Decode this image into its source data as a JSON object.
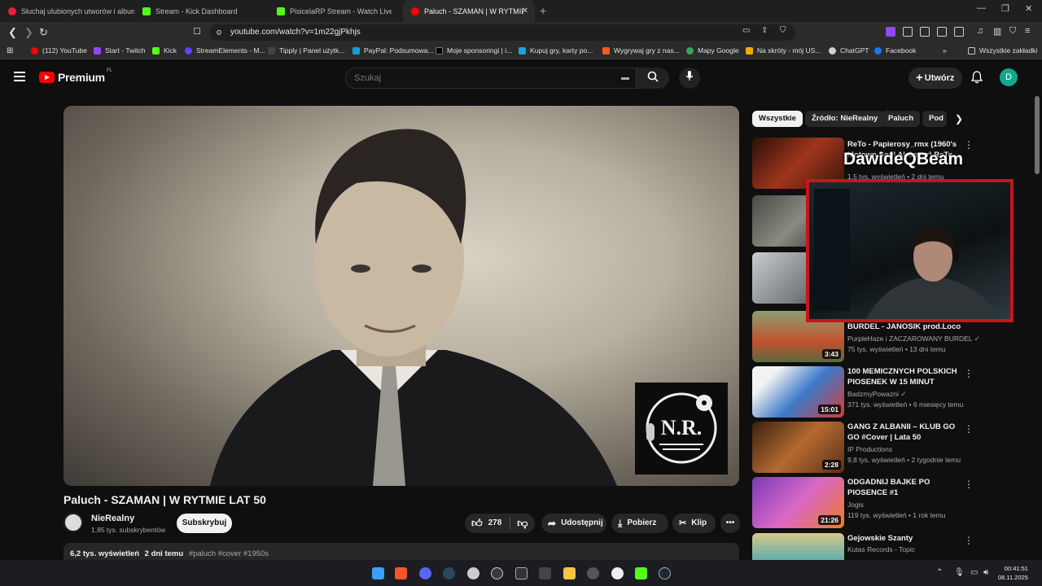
{
  "browser": {
    "tabs": [
      {
        "label": "Słuchaj ulubionych utworów i albumów",
        "color": "#e8213c"
      },
      {
        "label": "Stream - Kick Dashboard",
        "color": "#53fc18"
      },
      {
        "label": "PisicelaRP Stream - Watch Live on Kick",
        "color": "#53fc18"
      },
      {
        "label": "Paluch - SZAMAN | W RYTMIE LAT 50",
        "color": "#ff0000"
      }
    ],
    "new_tab": "+",
    "url": "youtube.com/watch?v=1m22gjPkhjs",
    "bookmarks": [
      {
        "label": "(112) YouTube",
        "color": "#ff0000"
      },
      {
        "label": "Start - Twitch",
        "color": "#9146ff"
      },
      {
        "label": "Kick",
        "color": "#53fc18"
      },
      {
        "label": "StreamElements - M...",
        "color": "#5a47ff"
      },
      {
        "label": "Tipply | Panel użytk...",
        "color": "#222222"
      },
      {
        "label": "PayPal: Podsumowa...",
        "color": "#169bd7"
      },
      {
        "label": "Moje sponsoringi | i...",
        "color": "#000000"
      },
      {
        "label": "Kupuj gry, karty po...",
        "color": "#1ba0e0"
      },
      {
        "label": "Wygrywaj gry z nas...",
        "color": "#ff5a1f"
      },
      {
        "label": "Mapy Google",
        "color": "#34a853"
      },
      {
        "label": "Na skróty - mój US...",
        "color": "#f2a900"
      },
      {
        "label": "ChatGPT",
        "color": "#d0d0d0"
      },
      {
        "label": "Facebook",
        "color": "#1877f2"
      }
    ],
    "all_bookmarks": "Wszystkie zakładki",
    "more_bookmarks": "»"
  },
  "youtube": {
    "logo_text": "Premium",
    "logo_region": "PL",
    "search_placeholder": "Szukaj",
    "create_label": "Utwórz",
    "avatar_letter": "D",
    "video": {
      "title": "Paluch - SZAMAN | W RYTMIE LAT 50",
      "channel": "NieRealny",
      "subscribers": "1,85 tys. subskrybentów",
      "subscribe_label": "Subskrybuj",
      "likes": "278",
      "share_label": "Udostępnij",
      "download_label": "Pobierz",
      "clip_label": "Klip",
      "views": "6,2 tys. wyświetleń",
      "age": "2 dni temu",
      "tags": "#paluch #cover #1950s",
      "logo_text": "N.R."
    },
    "chips": [
      "Wszystkie",
      "Źródło: NieRealny",
      "Paluch",
      "Pod"
    ],
    "recommendations": [
      {
        "title": "ReTo - Papierosy_rmx  (1960's Motown Soul AI Cover) ReTo ...",
        "channel": "",
        "meta": "1,5 tys. wyświetleń • 2 dni temu",
        "duration": "",
        "thumb": "#7a2416"
      },
      {
        "title": "",
        "channel": "",
        "meta": "",
        "duration": "",
        "thumb": "#5a5a52"
      },
      {
        "title": "",
        "channel": "",
        "meta": "",
        "duration": "",
        "thumb": "#8a8e92"
      },
      {
        "title": "BURDEL - JANOSIK prod.Loco",
        "channel": "PurpleHaze i ZACZAROWANY BURDEL",
        "meta": "75 tys. wyświetleń • 13 dni temu",
        "duration": "3:43",
        "thumb": "#6a8a5a"
      },
      {
        "title": "100 MEMICZNYCH POLSKICH PIOSENEK W 15 MINUT",
        "channel": "BadzmyPowazni",
        "meta": "371 tys. wyświetleń • 6 miesięcy temu",
        "duration": "15:01",
        "thumb": "#3a7ac8"
      },
      {
        "title": "GANG Z ALBANII – KLUB GO GO #Cover | Lata 50",
        "channel": "IP Productions",
        "meta": "9,8 tys. wyświetleń • 2 tygodnie temu",
        "duration": "2:28",
        "thumb": "#8a4a1e"
      },
      {
        "title": "ODGADNIJ BAJKE PO PIOSENCE #1",
        "channel": "Jogis",
        "meta": "119 tys. wyświetleń • 1 rok temu",
        "duration": "21:26",
        "thumb": "#b45ad0"
      },
      {
        "title": "Gejowskie Szanty",
        "channel": "Kutas Records - Topic",
        "meta": "",
        "duration": "",
        "thumb": "#3aa6b4"
      }
    ]
  },
  "stream_overlay": {
    "name": "DawideQBeam"
  },
  "taskbar": {
    "time": "00:41:51",
    "date": "08.11.2025",
    "icons": [
      {
        "name": "windows-start",
        "color": "#3aa0ff"
      },
      {
        "name": "brave",
        "color": "#fb542b"
      },
      {
        "name": "discord",
        "color": "#5865f2"
      },
      {
        "name": "steam",
        "color": "#2a475e"
      },
      {
        "name": "chrome",
        "color": "#cccccc"
      },
      {
        "name": "obs",
        "color": "#3a3a3a"
      },
      {
        "name": "terminal",
        "color": "#333333"
      },
      {
        "name": "davinci",
        "color": "#444444"
      },
      {
        "name": "explorer",
        "color": "#f5c542"
      },
      {
        "name": "app",
        "color": "#555555"
      },
      {
        "name": "github",
        "color": "#eeeeee"
      },
      {
        "name": "kick",
        "color": "#53fc18"
      },
      {
        "name": "steam2",
        "color": "#1b2838"
      }
    ]
  }
}
